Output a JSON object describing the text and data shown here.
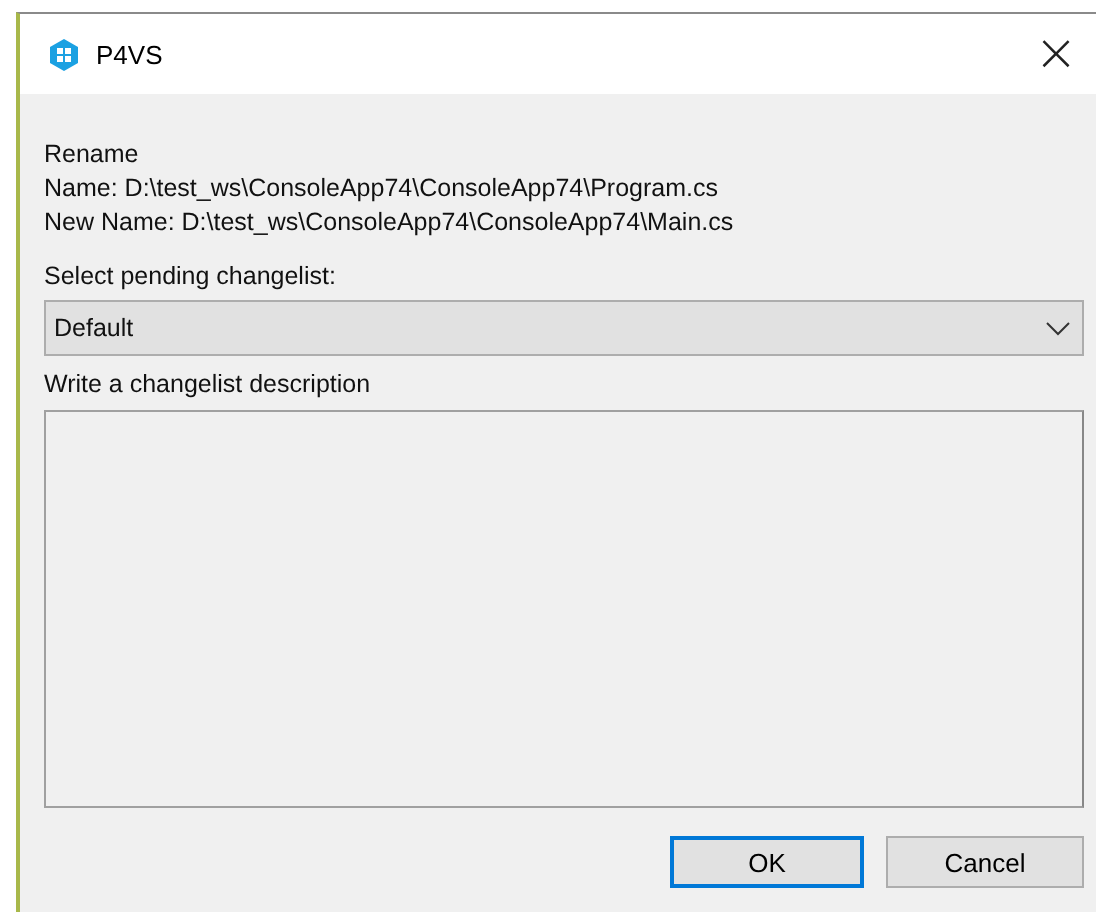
{
  "window": {
    "title": "P4VS",
    "close": "×"
  },
  "info": {
    "heading": "Rename",
    "lines": [
      "Name: D:\\test_ws\\ConsoleApp74\\ConsoleApp74\\Program.cs",
      "New Name: D:\\test_ws\\ConsoleApp74\\ConsoleApp74\\Main.cs"
    ]
  },
  "changelist": {
    "label": "Select pending changelist:",
    "value": "Default"
  },
  "description": {
    "label": "Write a changelist description"
  },
  "buttons": [
    {
      "label": "OK",
      "kind": "default"
    },
    {
      "label": "Cancel",
      "kind": "normal"
    }
  ]
}
